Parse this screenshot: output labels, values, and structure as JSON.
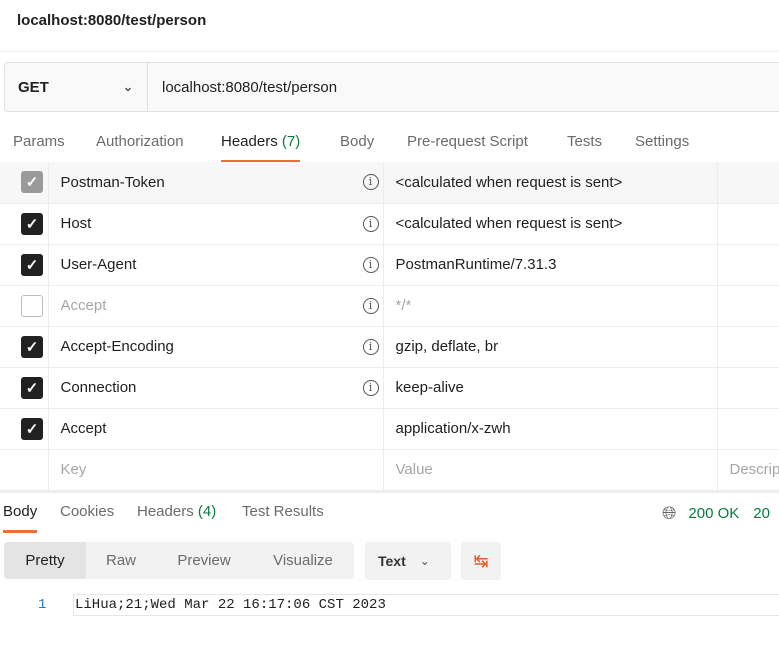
{
  "title": "localhost:8080/test/person",
  "request": {
    "method": "GET",
    "url": "localhost:8080/test/person"
  },
  "req_tabs": {
    "params": "Params",
    "authorization": "Authorization",
    "headers": "Headers",
    "headers_count": "(7)",
    "body": "Body",
    "prerequest": "Pre-request Script",
    "tests": "Tests",
    "settings": "Settings"
  },
  "headers": [
    {
      "key": "Postman-Token",
      "value": "<calculated when request is sent>",
      "checked": true,
      "locked": true,
      "info": true
    },
    {
      "key": "Host",
      "value": "<calculated when request is sent>",
      "checked": true,
      "info": true
    },
    {
      "key": "User-Agent",
      "value": "PostmanRuntime/7.31.3",
      "checked": true,
      "info": true
    },
    {
      "key": "Accept",
      "value": "*/*",
      "checked": false,
      "info": true
    },
    {
      "key": "Accept-Encoding",
      "value": "gzip, deflate, br",
      "checked": true,
      "info": true
    },
    {
      "key": "Connection",
      "value": "keep-alive",
      "checked": true,
      "info": true
    },
    {
      "key": "Accept",
      "value": "application/x-zwh",
      "checked": true,
      "info": false
    }
  ],
  "new_row": {
    "key_placeholder": "Key",
    "value_placeholder": "Value",
    "desc_placeholder": "Descrip"
  },
  "res_tabs": {
    "body": "Body",
    "cookies": "Cookies",
    "headers": "Headers",
    "headers_count": "(4)",
    "tests": "Test Results"
  },
  "status": {
    "code": "200 OK",
    "time": "20"
  },
  "view": {
    "pretty": "Pretty",
    "raw": "Raw",
    "preview": "Preview",
    "visualize": "Visualize",
    "format": "Text"
  },
  "response": {
    "line_number": "1",
    "text": "LiHua;21;Wed Mar 22 16:17:06 CST 2023"
  },
  "colors": {
    "accent": "#f26b3a",
    "success": "#0b7a3e"
  }
}
